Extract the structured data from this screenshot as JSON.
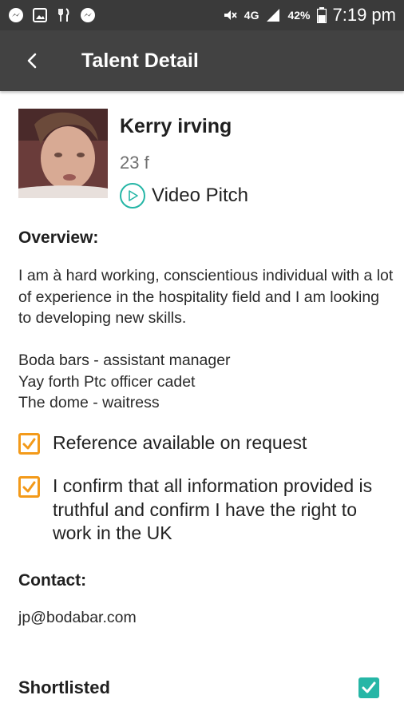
{
  "status_bar": {
    "battery_percent": "42%",
    "network": "4G",
    "time": "7:19 pm",
    "left_icons": [
      "messenger-icon",
      "gallery-icon",
      "restaurant-icon",
      "messenger-icon"
    ],
    "right_icons": [
      "mute-icon",
      "signal-icon",
      "battery-icon"
    ]
  },
  "toolbar": {
    "title": "Talent Detail",
    "back_icon": "chevron-left-icon"
  },
  "profile": {
    "name": "Kerry irving",
    "age": "23 f",
    "video_label": "Video Pitch",
    "video_icon": "play-circle-icon"
  },
  "overview": {
    "title": "Overview:",
    "text": "I am à hard working, conscientious individual with a lot of experience in the hospitality field and I am looking to developing new skills.\n\nBoda bars - assistant manager\nYay forth Ptc officer cadet\nThe dome - waitress"
  },
  "checks": {
    "reference": {
      "label": "Reference available on request",
      "checked": true
    },
    "confirm": {
      "label": "I confirm that all information provided is truthful and confirm I have the right to work in the UK",
      "checked": true
    }
  },
  "contact": {
    "title": "Contact:",
    "email": "jp@bodabar.com"
  },
  "shortlist": {
    "label": "Shortlisted",
    "checked": true
  },
  "colors": {
    "toolbar": "#424242",
    "status_bar": "#3a3a3a",
    "accent_teal": "#26b6a6",
    "checkbox_orange": "#f39a1a"
  }
}
